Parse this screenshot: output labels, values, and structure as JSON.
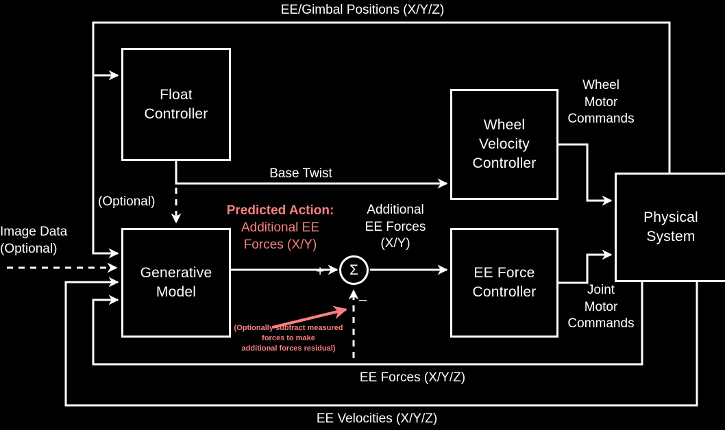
{
  "diagram": {
    "title": "Robot control architecture block diagram",
    "background_color": "#000000",
    "line_color": "#ffffff",
    "accent_color": "#f98080",
    "nodes": [
      {
        "id": "float_controller",
        "lines": [
          "Float",
          "Controller"
        ]
      },
      {
        "id": "generative_model",
        "lines": [
          "Generative",
          "Model"
        ]
      },
      {
        "id": "wheel_velocity_controller",
        "lines": [
          "Wheel",
          "Velocity",
          "Controller"
        ]
      },
      {
        "id": "ee_force_controller",
        "lines": [
          "EE Force",
          "Controller"
        ]
      },
      {
        "id": "physical_system",
        "lines": [
          "Physical",
          "System"
        ]
      },
      {
        "id": "summation",
        "symbol": "Σ"
      }
    ],
    "labels": {
      "top_feedback": "EE/Gimbal Positions (X/Y/Z)",
      "base_twist": "Base Twist",
      "float_optional": "(Optional)",
      "image_data": [
        "Image Data",
        "(Optional)"
      ],
      "additional_ee_forces_white": [
        "Additional",
        "EE Forces",
        "(X/Y)"
      ],
      "wheel_motor_commands": [
        "Wheel",
        "Motor",
        "Commands"
      ],
      "joint_motor_commands": [
        "Joint",
        "Motor",
        "Commands"
      ],
      "ee_forces_feedback": "EE Forces (X/Y/Z)",
      "ee_velocities_feedback": "EE Velocities (X/Y/Z)"
    },
    "accent_labels": {
      "predicted_action": {
        "heading": "Predicted Action:",
        "lines": [
          "Additional EE",
          "Forces (X/Y)"
        ]
      },
      "residual_note": [
        "(Optionally subtract measured",
        "forces to make",
        "additional forces residual)"
      ]
    },
    "signs": {
      "plus": "+",
      "minus": "–"
    }
  }
}
